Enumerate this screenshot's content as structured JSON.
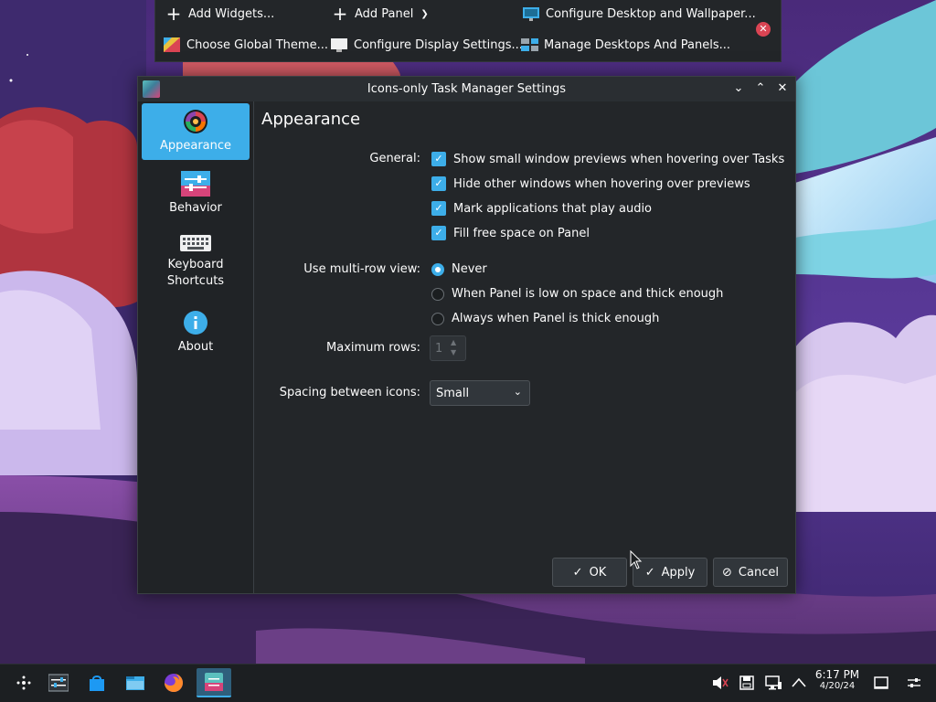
{
  "edit_toolbar": {
    "add_widgets": "Add Widgets...",
    "add_panel": "Add Panel",
    "configure_desktop": "Configure Desktop and Wallpaper...",
    "choose_theme": "Choose Global Theme...",
    "configure_display": "Configure Display Settings...",
    "manage_desktops": "Manage Desktops And Panels..."
  },
  "dialog": {
    "title": "Icons-only Task Manager Settings",
    "sidebar": [
      {
        "label": "Appearance",
        "active": true
      },
      {
        "label": "Behavior"
      },
      {
        "label": "Keyboard Shortcuts"
      },
      {
        "label": "About"
      }
    ],
    "page_title": "Appearance",
    "general_label": "General:",
    "checkboxes": [
      {
        "label": "Show small window previews when hovering over Tasks",
        "checked": true
      },
      {
        "label": "Hide other windows when hovering over previews",
        "checked": true
      },
      {
        "label": "Mark applications that play audio",
        "checked": true
      },
      {
        "label": "Fill free space on Panel",
        "checked": true
      }
    ],
    "multirow_label": "Use multi-row view:",
    "radios": [
      {
        "label": "Never",
        "selected": true
      },
      {
        "label": "When Panel is low on space and thick enough",
        "selected": false
      },
      {
        "label": "Always when Panel is thick enough",
        "selected": false
      }
    ],
    "max_rows_label": "Maximum rows:",
    "max_rows_value": "1",
    "spacing_label": "Spacing between icons:",
    "spacing_value": "Small",
    "buttons": {
      "ok": "OK",
      "apply": "Apply",
      "cancel": "Cancel"
    }
  },
  "taskbar": {
    "time": "6:17 PM",
    "date": "4/20/24"
  },
  "colors": {
    "accent": "#3daee9",
    "danger": "#da4453"
  }
}
